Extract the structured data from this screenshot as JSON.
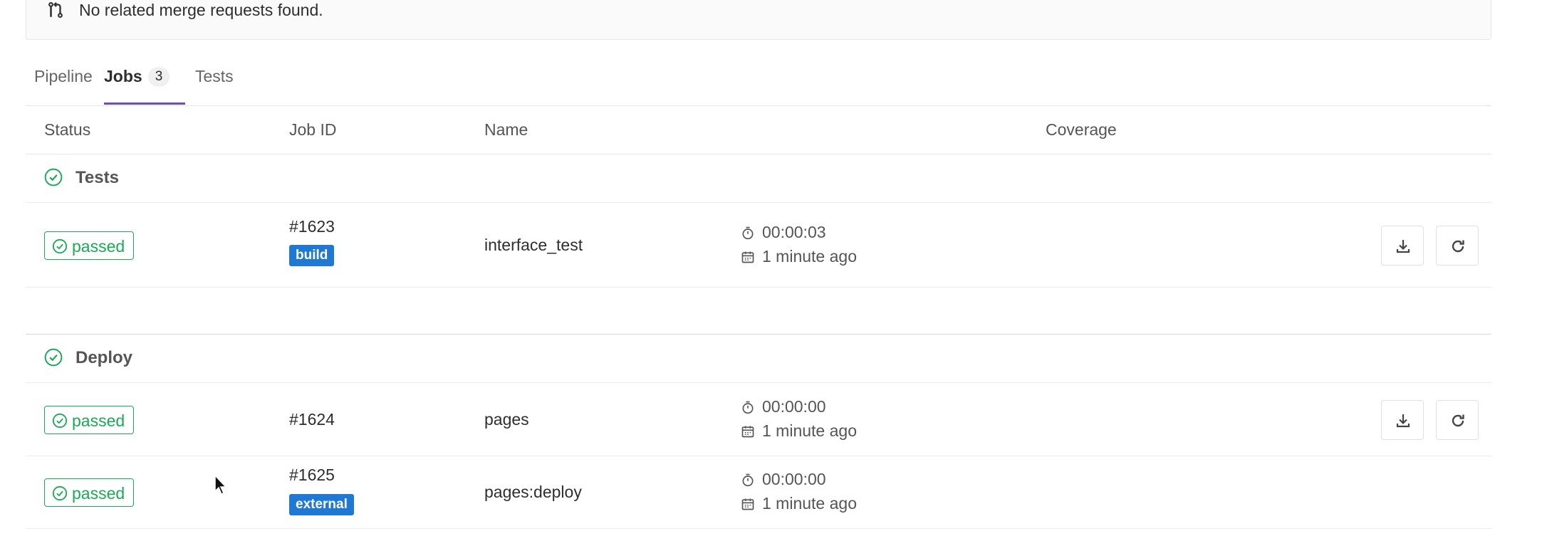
{
  "merge_request": {
    "text": "No related merge requests found.",
    "icon": "merge-request-icon"
  },
  "tabs": [
    {
      "label": "Pipeline"
    },
    {
      "label": "Jobs",
      "count": "3",
      "active": true
    },
    {
      "label": "Tests"
    }
  ],
  "table": {
    "headers": {
      "status": "Status",
      "job_id": "Job ID",
      "name": "Name",
      "coverage": "Coverage"
    }
  },
  "stages": [
    {
      "name": "Tests",
      "jobs": [
        {
          "status": "passed",
          "id": "#1623",
          "tag": "build",
          "name": "interface_test",
          "duration": "00:00:03",
          "finished": "1 minute ago",
          "actions": [
            "download-artifacts",
            "retry"
          ]
        }
      ]
    },
    {
      "name": "Deploy",
      "jobs": [
        {
          "status": "passed",
          "id": "#1624",
          "tag": "",
          "name": "pages",
          "duration": "00:00:00",
          "finished": "1 minute ago",
          "actions": [
            "download-artifacts",
            "retry"
          ]
        },
        {
          "status": "passed",
          "id": "#1625",
          "tag": "external",
          "name": "pages:deploy",
          "duration": "00:00:00",
          "finished": "1 minute ago",
          "actions": []
        }
      ]
    }
  ],
  "colors": {
    "success": "#1aaa55",
    "tag_blue": "#1f78d1",
    "tab_underline": "#6b4fbb"
  }
}
